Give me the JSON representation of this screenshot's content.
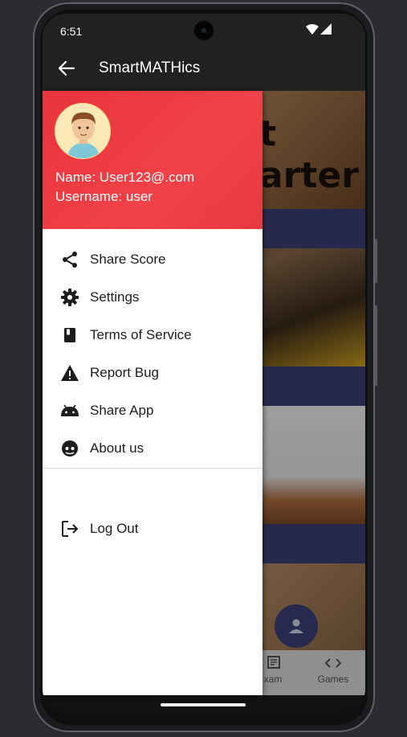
{
  "status_bar": {
    "time": "6:51"
  },
  "app_bar": {
    "title": "SmartMATHics"
  },
  "drawer": {
    "name_line": "Name: User123@.com",
    "username_line": "Username: user",
    "items": [
      {
        "label": "Share Score",
        "icon": "share-icon"
      },
      {
        "label": "Settings",
        "icon": "gear-icon"
      },
      {
        "label": "Terms of Service",
        "icon": "book-icon"
      },
      {
        "label": "Report Bug",
        "icon": "warning-icon"
      },
      {
        "label": "Share App",
        "icon": "android-icon"
      },
      {
        "label": "About us",
        "icon": "face-icon"
      }
    ],
    "logout_label": "Log Out"
  },
  "background": {
    "card_text_1": "t",
    "card_text_2": "arter"
  },
  "bottom_nav": {
    "items": [
      {
        "label": "xam",
        "icon": "exam-icon"
      },
      {
        "label": "Games",
        "icon": "code-icon"
      }
    ]
  },
  "colors": {
    "drawer_header": "#e8343a",
    "accent": "#3d4179",
    "app_bar": "#212121"
  }
}
